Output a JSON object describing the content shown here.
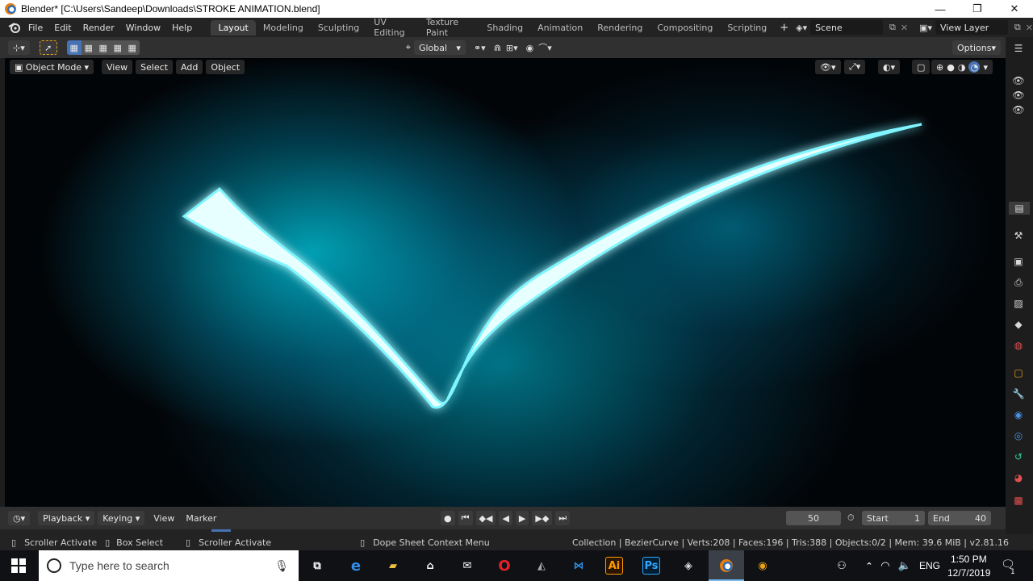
{
  "window": {
    "title": "Blender* [C:\\Users\\Sandeep\\Downloads\\STROKE ANIMATION.blend]",
    "minimize_glyph": "—",
    "maximize_glyph": "❐",
    "close_glyph": "✕"
  },
  "menubar": {
    "items": [
      "File",
      "Edit",
      "Render",
      "Window",
      "Help"
    ]
  },
  "workspaces": {
    "tabs": [
      "Layout",
      "Modeling",
      "Sculpting",
      "UV Editing",
      "Texture Paint",
      "Shading",
      "Animation",
      "Rendering",
      "Compositing",
      "Scripting"
    ],
    "active": "Layout",
    "add_glyph": "+"
  },
  "scene": {
    "name": "Scene"
  },
  "view_layer": {
    "name": "View Layer"
  },
  "tool_header": {
    "transform_orientation": "Global",
    "options_label": "Options"
  },
  "viewport_header": {
    "mode": "Object Mode",
    "menus": [
      "View",
      "Select",
      "Add",
      "Object"
    ]
  },
  "timeline": {
    "menus": [
      "Playback",
      "Keying",
      "View",
      "Marker"
    ],
    "current_frame": "50",
    "start_label": "Start",
    "start_value": "1",
    "end_label": "End",
    "end_value": "40"
  },
  "statusbar": {
    "left": [
      "Scroller Activate",
      "Box Select",
      "Scroller Activate"
    ],
    "middle": "Dope Sheet Context Menu",
    "stats": "Collection | BezierCurve | Verts:208 | Faces:196 | Tris:388 | Objects:0/2 | Mem: 39.6 MiB | v2.81.16"
  },
  "taskbar": {
    "search_placeholder": "Type here to search",
    "language": "ENG",
    "time": "1:50 PM",
    "date": "12/7/2019",
    "notification_count": "1",
    "apps": [
      "Ai",
      "Ps"
    ]
  },
  "colors": {
    "blender_bg": "#1d1d1d",
    "header": "#303030",
    "active_tab": "#3d3d3d",
    "stroke_core": "#e8ffff",
    "stroke_glow": "#00e5ff",
    "accent_blue": "#4772b3"
  }
}
